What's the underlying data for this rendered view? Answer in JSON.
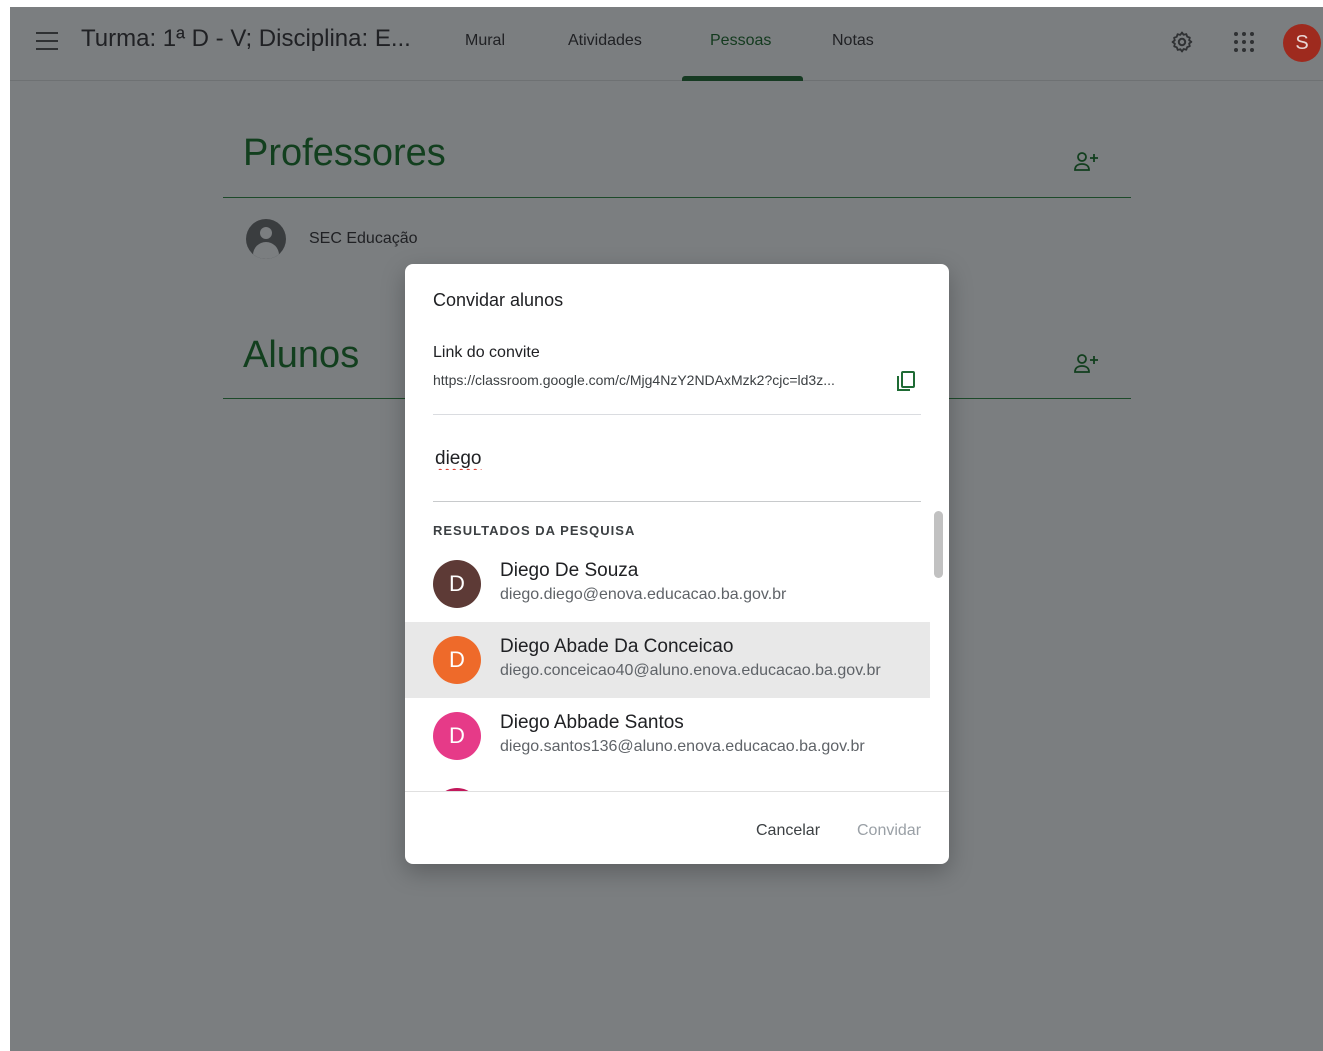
{
  "header": {
    "menu_icon": "hamburger-menu-icon",
    "class_title": "Turma: 1ª D - V; Disciplina: E...",
    "tabs": [
      {
        "label": "Mural",
        "active": false
      },
      {
        "label": "Atividades",
        "active": false
      },
      {
        "label": "Pessoas",
        "active": true
      },
      {
        "label": "Notas",
        "active": false
      }
    ],
    "settings_icon": "gear-icon",
    "apps_icon": "apps-grid-icon",
    "account_initial": "S",
    "account_color": "#9e2a1e"
  },
  "people": {
    "teachers_title": "Professores",
    "teachers": [
      {
        "name": "SEC Educação"
      }
    ],
    "students_title": "Alunos",
    "add_icon": "add-person-icon"
  },
  "dialog": {
    "title": "Convidar alunos",
    "link_label": "Link do convite",
    "link_url": "https://classroom.google.com/c/Mjg4NzY2NDAxMzk2?cjc=ld3z...",
    "copy_icon": "copy-icon",
    "search_value": "diego",
    "results_heading": "RESULTADOS DA PESQUISA",
    "results": [
      {
        "initial": "D",
        "name": "Diego De Souza",
        "email": "diego.diego@enova.educacao.ba.gov.br",
        "color": "#5d3a36",
        "hovered": false
      },
      {
        "initial": "D",
        "name": "Diego Abade Da Conceicao",
        "email": "diego.conceicao40@aluno.enova.educacao.ba.gov.br",
        "color": "#ee6a2a",
        "hovered": true
      },
      {
        "initial": "D",
        "name": "Diego Abbade Santos",
        "email": "diego.santos136@aluno.enova.educacao.ba.gov.br",
        "color": "#e63a88",
        "hovered": false
      }
    ],
    "cancel_label": "Cancelar",
    "invite_label": "Convidar"
  },
  "colors": {
    "accent_green": "#1e6b34",
    "scrim": "#7b7e80"
  }
}
